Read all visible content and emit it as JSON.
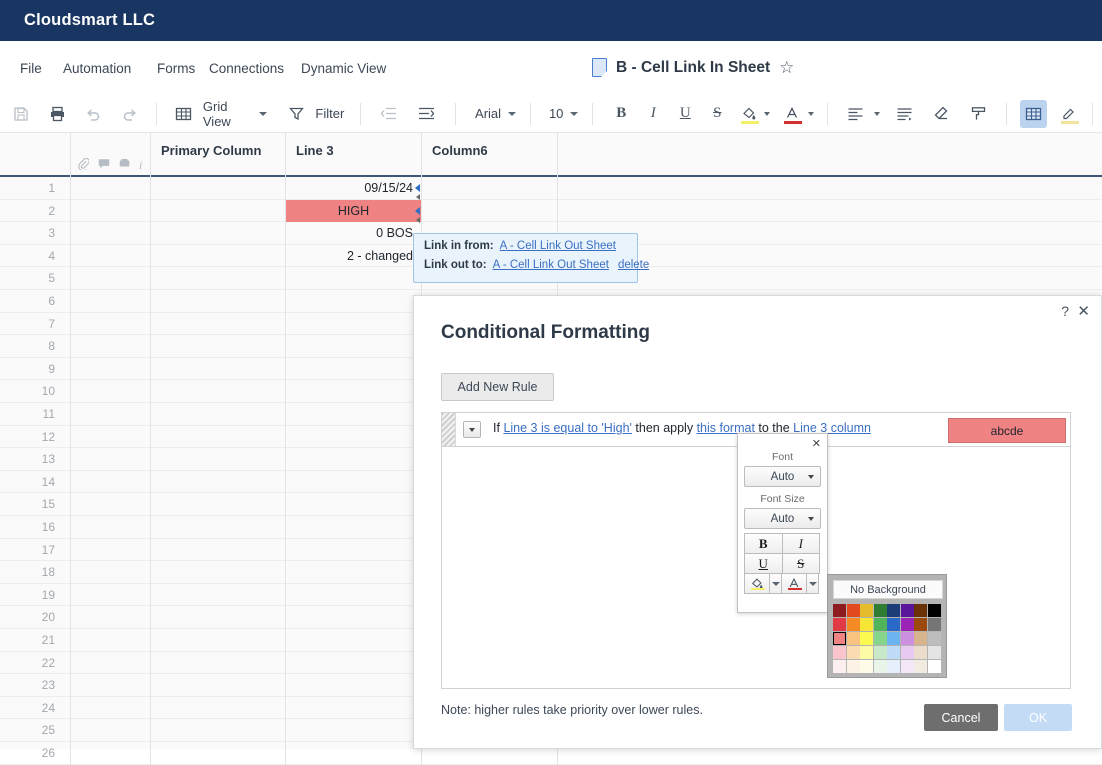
{
  "brand": {
    "name": "Cloudsmart LLC"
  },
  "menu": {
    "items": [
      "File",
      "Automation",
      "Forms",
      "Connections",
      "Dynamic View"
    ]
  },
  "document": {
    "title": "B - Cell Link In Sheet",
    "star_icon": "star-outline-icon",
    "sheet_icon": "sheet-icon"
  },
  "toolbar": {
    "save_icon": "save-icon",
    "print_icon": "print-icon",
    "undo_icon": "undo-icon",
    "redo_icon": "redo-icon",
    "view_label": "Grid View",
    "view_icon": "grid-icon",
    "filter_label": "Filter",
    "filter_icon": "funnel-icon",
    "outdent_icon": "outdent-icon",
    "indent_icon": "indent-icon",
    "font_name": "Arial",
    "font_size": "10",
    "bold": "B",
    "italic": "I",
    "underline": "U",
    "strike": "S",
    "fill_icon": "fill-color-icon",
    "fill_color": "#f5f06a",
    "text_color_icon": "text-color-icon",
    "text_color": "#d32f2f",
    "align_icon": "align-left-icon",
    "wrap_icon": "wrap-text-icon",
    "clear_format_icon": "clear-format-icon",
    "format_painter_icon": "format-painter-icon",
    "grid_toggle_icon": "grid-toggle-icon",
    "highlight_icon": "highlighter-icon",
    "highlight_color": "#f3e3a0"
  },
  "grid": {
    "row_icons": [
      "attachment-icon",
      "comment-icon",
      "proof-icon",
      "info-icon"
    ],
    "columns": [
      "Primary Column",
      "Line 3",
      "Column6"
    ],
    "row_count": 26,
    "cells": [
      {
        "row": 1,
        "column": "Line 3",
        "value": "09/15/24",
        "highlighted": false,
        "linked": true
      },
      {
        "row": 2,
        "column": "Line 3",
        "value": "HIGH",
        "highlighted": true,
        "linked": true
      },
      {
        "row": 3,
        "column": "Line 3",
        "value": "0 BOS",
        "highlighted": false,
        "linked": false
      },
      {
        "row": 4,
        "column": "Line 3",
        "value": "2 - changed",
        "highlighted": false,
        "linked": false
      }
    ],
    "highlight_color": "#ef8282"
  },
  "link_popup": {
    "in_label": "Link in from:",
    "in_sheet": "A - Cell Link Out Sheet",
    "out_label": "Link out to:",
    "out_sheet": "A - Cell Link Out Sheet",
    "delete_label": "delete"
  },
  "modal": {
    "title": "Conditional Formatting",
    "help_icon": "help-icon",
    "close_icon": "close-icon",
    "add_rule_label": "Add New Rule",
    "rule": {
      "if_label": "If",
      "condition": "Line 3 is equal to 'High'",
      "then_label": "then apply",
      "format_link": "this format",
      "to_label": "to the",
      "target_column": "Line 3 column",
      "preview_text": "abcde",
      "preview_color": "#ef8282",
      "dropdown_icon": "chevron-down-icon",
      "drag_handle_icon": "drag-handle-icon"
    },
    "note": "Note: higher rules take priority over lower rules.",
    "cancel_label": "Cancel",
    "ok_label": "OK"
  },
  "format_popup": {
    "close_icon": "close-icon",
    "font_label": "Font",
    "font_value": "Auto",
    "font_size_label": "Font Size",
    "font_size_value": "Auto",
    "bold": "B",
    "italic": "I",
    "underline": "U",
    "strike": "S",
    "fill_icon": "fill-color-icon",
    "fill_color": "#f5f06a",
    "text_color_icon": "text-color-icon",
    "text_color": "#d32f2f"
  },
  "palette": {
    "no_background_label": "No Background",
    "selected": {
      "row": 2,
      "col": 0,
      "color": "#ef8282"
    },
    "rows": [
      [
        "#8e1b1f",
        "#e2491e",
        "#e5bd2c",
        "#2e7d32",
        "#1c3d78",
        "#5b159b",
        "#6b3207",
        "#000000"
      ],
      [
        "#e03a45",
        "#f68a25",
        "#f7e635",
        "#4fb45a",
        "#2a69c8",
        "#9b23b8",
        "#9c4a0c",
        "#757575"
      ],
      [
        "#ef8282",
        "#f8c281",
        "#fbfb4f",
        "#87d48d",
        "#6bb4f0",
        "#cd8fe0",
        "#d7b48d",
        "#bdbdbd"
      ],
      [
        "#fac4cc",
        "#fbdcb2",
        "#fdfba5",
        "#c8e8c8",
        "#bedcf8",
        "#e8c9f2",
        "#ecdccb",
        "#e4e4e4"
      ],
      [
        "#fdeef0",
        "#fdf2e6",
        "#fefce8",
        "#eaf5ea",
        "#e6f0fc",
        "#f3e7f8",
        "#f2ebe2",
        "#ffffff"
      ]
    ]
  }
}
